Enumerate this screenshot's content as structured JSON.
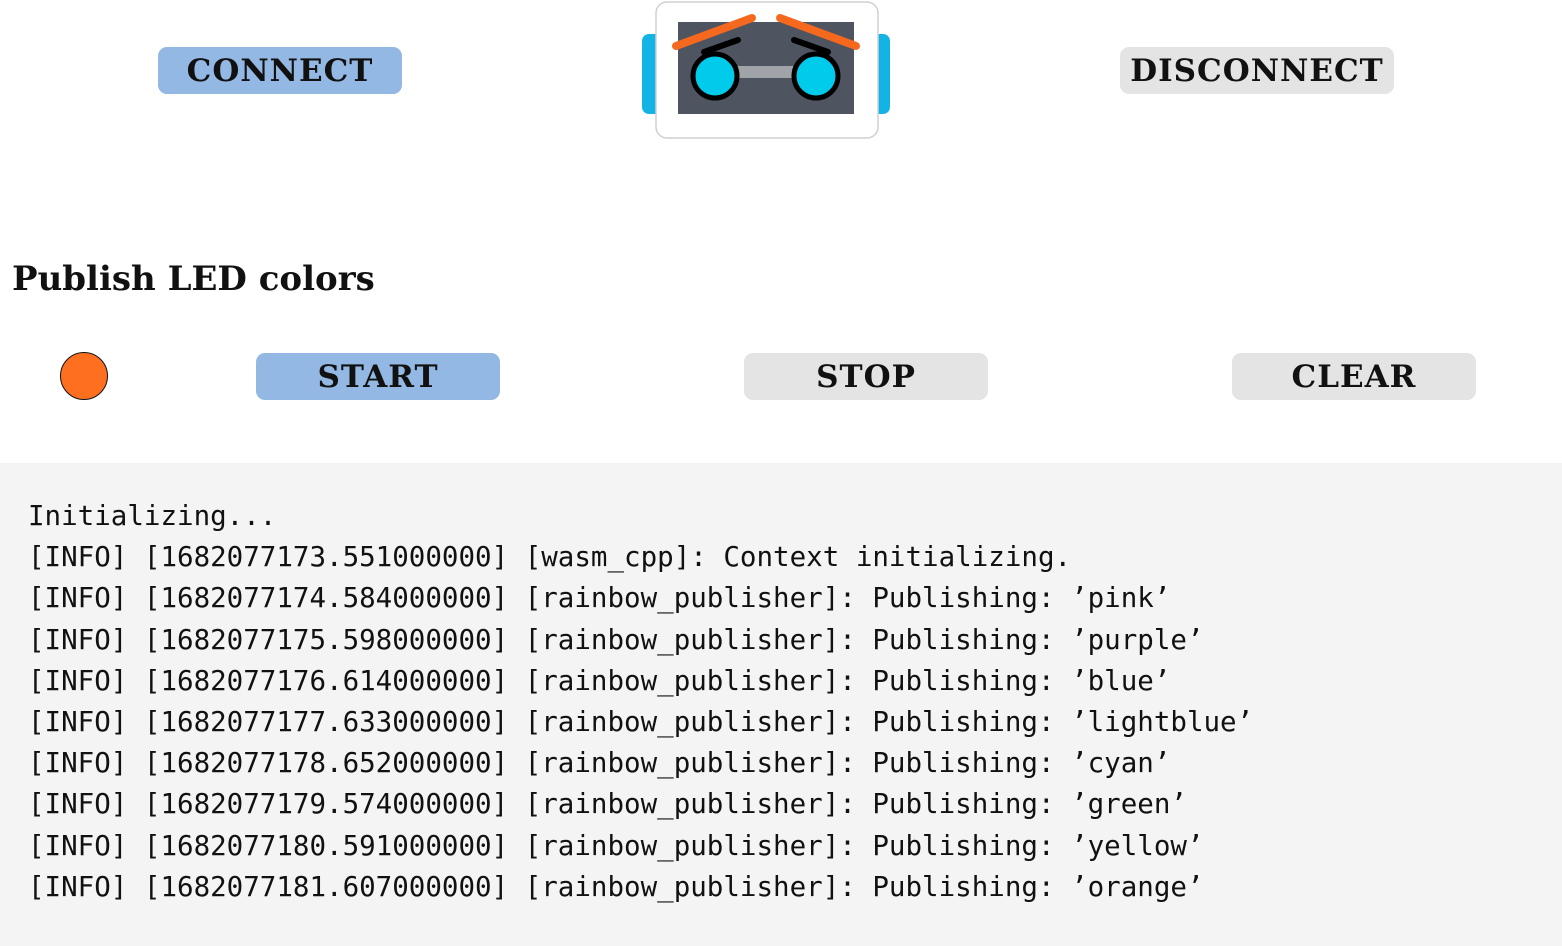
{
  "header": {
    "connect_label": "CONNECT",
    "disconnect_label": "DISCONNECT",
    "logo_icon": "robot-face-logo-icon"
  },
  "publish": {
    "title": "Publish LED colors",
    "led_color": "#fe6f20",
    "start_label": "START",
    "stop_label": "STOP",
    "clear_label": "CLEAR"
  },
  "console": {
    "lines": [
      "Initializing...",
      "[INFO] [1682077173.551000000] [wasm_cpp]: Context initializing.",
      "[INFO] [1682077174.584000000] [rainbow_publisher]: Publishing: ’pink’",
      "[INFO] [1682077175.598000000] [rainbow_publisher]: Publishing: ’purple’",
      "[INFO] [1682077176.614000000] [rainbow_publisher]: Publishing: ’blue’",
      "[INFO] [1682077177.633000000] [rainbow_publisher]: Publishing: ’lightblue’",
      "[INFO] [1682077178.652000000] [rainbow_publisher]: Publishing: ’cyan’",
      "[INFO] [1682077179.574000000] [rainbow_publisher]: Publishing: ’green’",
      "[INFO] [1682077180.591000000] [rainbow_publisher]: Publishing: ’yellow’",
      "[INFO] [1682077181.607000000] [rainbow_publisher]: Publishing: ’orange’"
    ]
  },
  "colors": {
    "primary_button": "#93b8e3",
    "secondary_button": "#e4e4e4",
    "console_background": "#f4f4f4",
    "logo_accent_blue": "#14b3e6",
    "logo_eyebrow_orange": "#f5681e",
    "logo_eye_cyan": "#00cbea",
    "logo_face_dark": "#4f5560"
  }
}
